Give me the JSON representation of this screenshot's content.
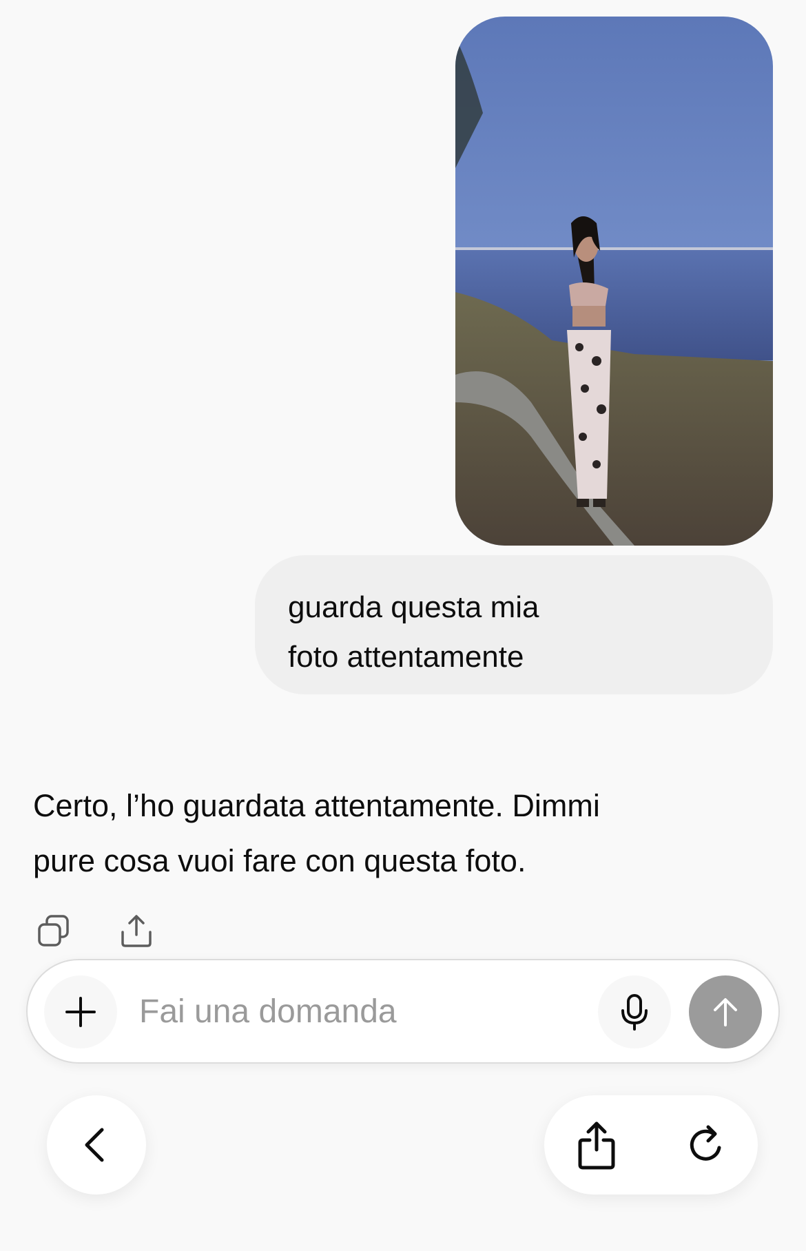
{
  "conversation": {
    "user_photo": {
      "alt": ""
    },
    "user_message": {
      "lines": [
        "guarda questa mia",
        "foto attentamente"
      ]
    },
    "assistant_message": {
      "lines": [
        "Certo, l’ho guardata attentamente. Dimmi",
        "pure cosa vuoi fare con questa foto."
      ]
    },
    "actions": [
      "copy-icon",
      "share-icon"
    ]
  },
  "composer": {
    "placeholder": "Fai una domanda",
    "value": "",
    "buttons": [
      "plus-icon",
      "microphone-icon",
      "send-arrow-icon"
    ],
    "send_color": "#9b9b9b"
  },
  "browser_nav": {
    "buttons": [
      "back-chevron-icon",
      "share-icon",
      "reload-icon"
    ]
  }
}
